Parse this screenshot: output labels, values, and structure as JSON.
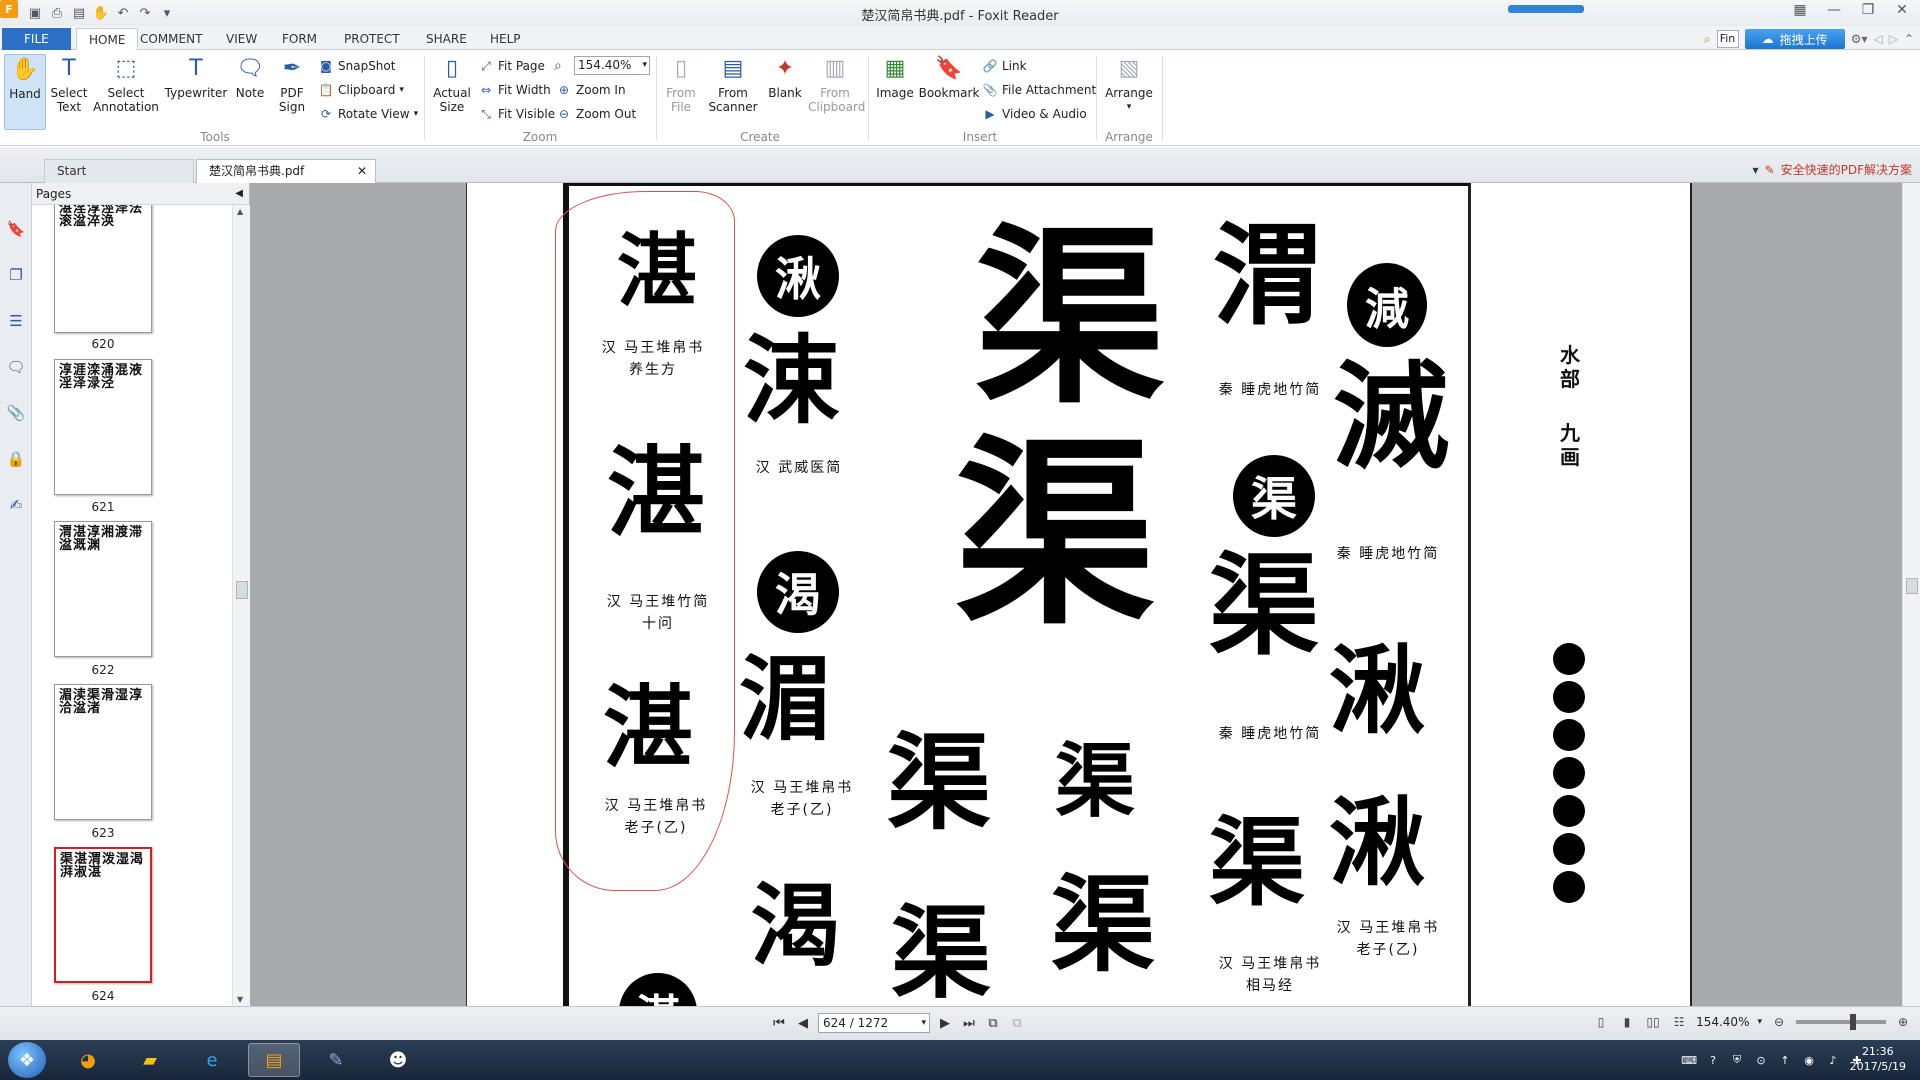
{
  "window": {
    "title": "楚汉简帛书典.pdf - Foxit Reader"
  },
  "ribbon_tabs": [
    "FILE",
    "HOME",
    "COMMENT",
    "VIEW",
    "FORM",
    "PROTECT",
    "SHARE",
    "HELP"
  ],
  "find": {
    "placeholder": "Fin"
  },
  "upload_button": "拖拽上传",
  "ribbon": {
    "tools": {
      "label": "Tools",
      "hand": "Hand",
      "select_text": "Select Text",
      "select_annotation": "Select Annotation",
      "typewriter": "Typewriter",
      "note": "Note",
      "pdf_sign": "PDF Sign"
    },
    "clipboard": {
      "snapshot": "SnapShot",
      "clipboard": "Clipboard",
      "rotate_view": "Rotate View"
    },
    "zoom": {
      "label": "Zoom",
      "actual_size": "Actual Size",
      "fit_page": "Fit Page",
      "fit_width": "Fit Width",
      "fit_visible": "Fit Visible",
      "zoom_value": "154.40%",
      "zoom_in": "Zoom In",
      "zoom_out": "Zoom Out"
    },
    "create": {
      "label": "Create",
      "from_file": "From File",
      "from_scanner": "From Scanner",
      "blank": "Blank",
      "from_clipboard": "From Clipboard"
    },
    "insert": {
      "label": "Insert",
      "image": "Image",
      "bookmark": "Bookmark",
      "link": "Link",
      "file_attachment": "File Attachment",
      "video_audio": "Video & Audio"
    },
    "arrange": {
      "label": "Arrange",
      "arrange": "Arrange"
    }
  },
  "doc_tabs": {
    "start": "Start",
    "current": "楚汉简帛书典.pdf",
    "promo": "安全快速的PDF解决方案"
  },
  "pages_panel": {
    "title": "Pages",
    "thumbnails": [
      {
        "label": "620",
        "glyphs": "湛淫淳涇泽法滚湓淬涣"
      },
      {
        "label": "621",
        "glyphs": "淳涯滦涌混液淫泽渌泾"
      },
      {
        "label": "622",
        "glyphs": "渭湛淳湘渡滞湓溉渊"
      },
      {
        "label": "623",
        "glyphs": "湄渎渠滑湿淳洽湓渚"
      },
      {
        "label": "624",
        "glyphs": "渠湛渭泼湿渴湃淑湛"
      }
    ]
  },
  "page_content": {
    "side_title_1": "水部",
    "side_title_2": "九画",
    "captions": [
      "汉 马王堆帛书",
      "养生方",
      "汉 武威医简",
      "汉 马王堆竹简",
      "十问",
      "汉 马王堆帛书",
      "老子(乙)",
      "汉 马王堆帛书",
      "老子(乙)",
      "秦 睡虎地竹简",
      "秦 睡虎地竹简",
      "秦 睡虎地竹简",
      "汉 马王堆帛书",
      "相马经",
      "汉 马王堆帛书",
      "老子(乙)"
    ],
    "circle_labels": [
      "湫",
      "渴",
      "渠",
      "減"
    ],
    "glyphs": [
      "湛",
      "湛",
      "湛",
      "涑",
      "湄",
      "渠",
      "渠",
      "渠",
      "渠",
      "渭",
      "渠",
      "渠",
      "渠",
      "滅",
      "湫",
      "湫",
      "渴",
      "湛"
    ]
  },
  "status": {
    "page_indicator": "624 / 1272",
    "zoom": "154.40%"
  },
  "taskbar": {
    "clock_time": "21:36",
    "clock_date": "2017/5/19"
  }
}
